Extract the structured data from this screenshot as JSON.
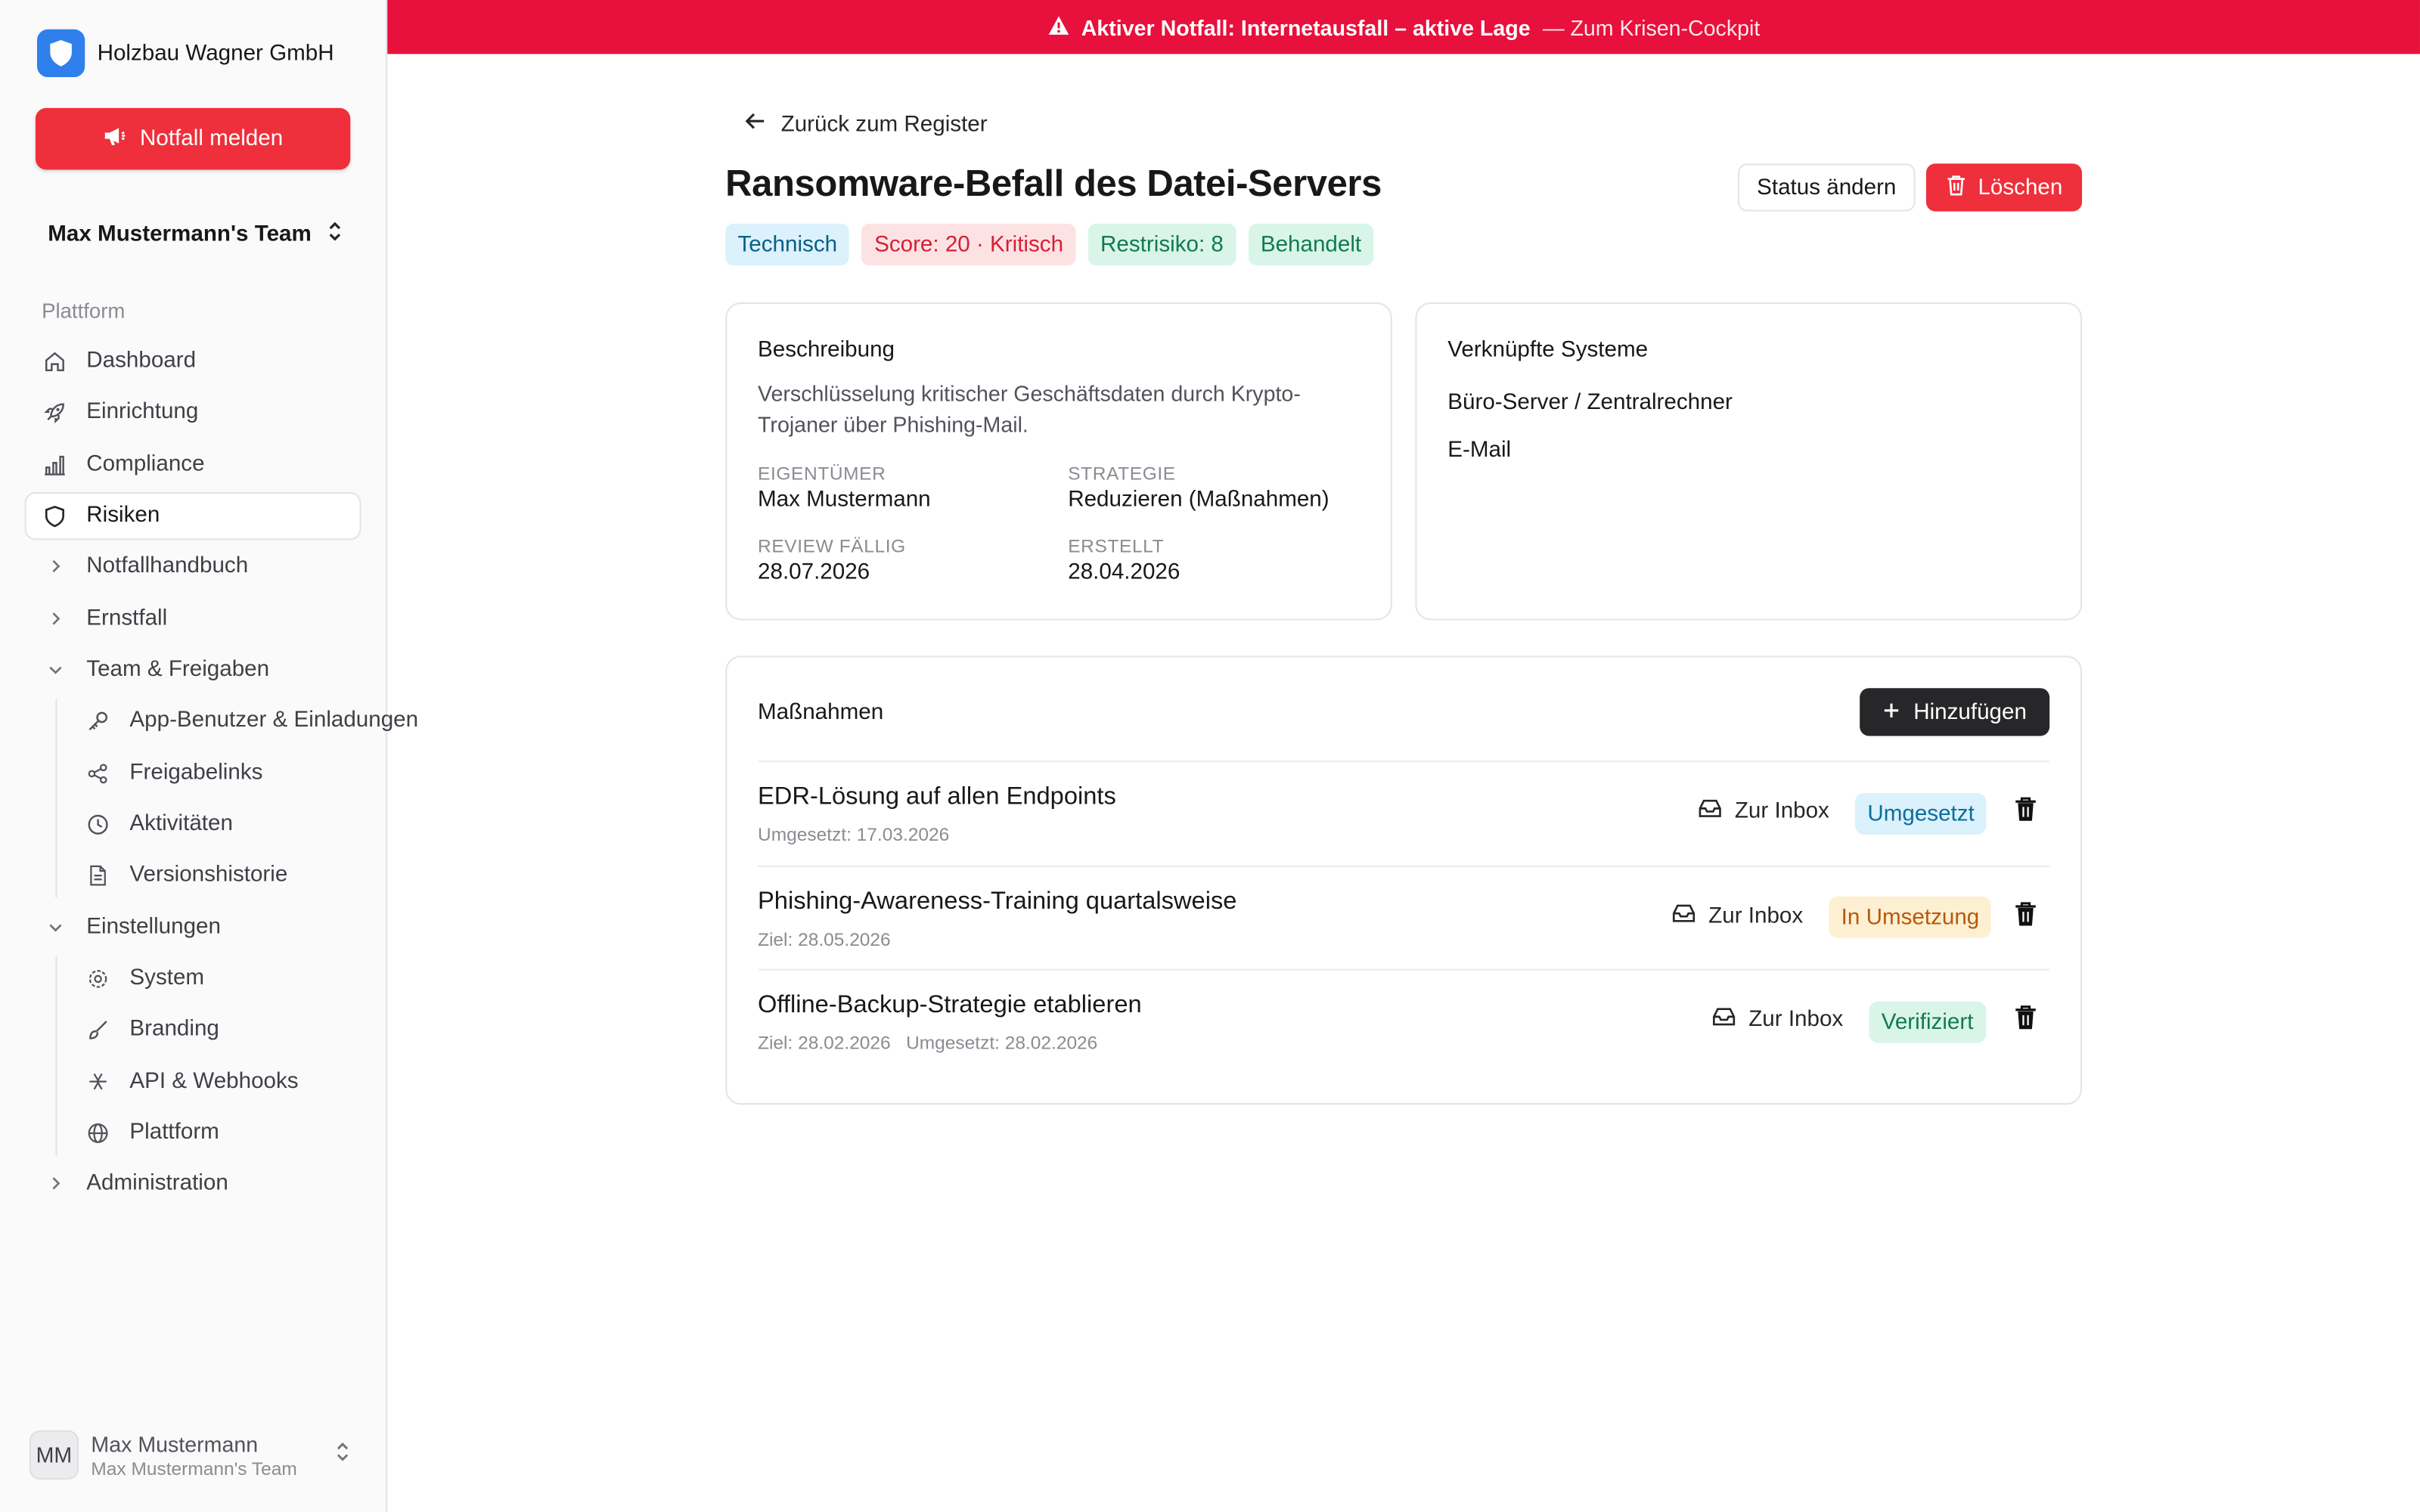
{
  "sidebar": {
    "company": "Holzbau Wagner GmbH",
    "emergency_button": "Notfall melden",
    "team_name": "Max Mustermann's Team",
    "section_label": "Plattform",
    "items": [
      {
        "label": "Dashboard",
        "icon": "home-icon"
      },
      {
        "label": "Einrichtung",
        "icon": "rocket-icon"
      },
      {
        "label": "Compliance",
        "icon": "bar-chart-icon"
      },
      {
        "label": "Risiken",
        "icon": "shield-icon",
        "active": true
      },
      {
        "label": "Notfallhandbuch",
        "icon": "chevron-right-icon"
      },
      {
        "label": "Ernstfall",
        "icon": "chevron-right-icon"
      },
      {
        "label": "Team & Freigaben",
        "icon": "chevron-down-icon"
      },
      {
        "label": "App-Benutzer & Einladungen",
        "icon": "key-icon"
      },
      {
        "label": "Freigabelinks",
        "icon": "share-icon"
      },
      {
        "label": "Aktivitäten",
        "icon": "clock-icon"
      },
      {
        "label": "Versionshistorie",
        "icon": "file-icon"
      },
      {
        "label": "Einstellungen",
        "icon": "chevron-down-icon"
      },
      {
        "label": "System",
        "icon": "gear-icon"
      },
      {
        "label": "Branding",
        "icon": "brush-icon"
      },
      {
        "label": "API & Webhooks",
        "icon": "webhook-icon"
      },
      {
        "label": "Plattform",
        "icon": "globe-icon"
      },
      {
        "label": "Administration",
        "icon": "chevron-right-icon"
      }
    ],
    "user": {
      "initials": "MM",
      "name": "Max Mustermann",
      "team": "Max Mustermann's Team"
    }
  },
  "banner": {
    "alert": "Aktiver Notfall: Internetausfall – aktive Lage",
    "link": "— Zum Krisen-Cockpit",
    "color": "#e8103c"
  },
  "header": {
    "back_link": "Zurück zum Register",
    "title": "Ransomware-Befall des Datei-Servers",
    "status_button": "Status ändern",
    "delete_button": "Löschen",
    "badges": [
      {
        "label": "Technisch",
        "bg": "#dbf1fc",
        "fg": "#0b5f86"
      },
      {
        "label": "Score: 20 · Kritisch",
        "bg": "#fde2e4",
        "fg": "#d61f33"
      },
      {
        "label": "Restrisiko: 8",
        "bg": "#d9f5ea",
        "fg": "#127a52"
      },
      {
        "label": "Behandelt",
        "bg": "#d9f5ea",
        "fg": "#127a52"
      }
    ]
  },
  "description_card": {
    "title": "Beschreibung",
    "text": "Verschlüsselung kritischer Geschäftsdaten durch Krypto-Trojaner über Phishing-Mail.",
    "meta": [
      {
        "label": "Eigentümer",
        "value": "Max Mustermann"
      },
      {
        "label": "Strategie",
        "value": "Reduzieren (Maßnahmen)"
      },
      {
        "label": "Review fällig",
        "value": "28.07.2026"
      },
      {
        "label": "Erstellt",
        "value": "28.04.2026"
      }
    ]
  },
  "systems_card": {
    "title": "Verknüpfte Systeme",
    "items": [
      "Büro-Server / Zentralrechner",
      "E-Mail"
    ]
  },
  "measures": {
    "title": "Maßnahmen",
    "add_button": "Hinzufügen",
    "inbox_label": "Zur Inbox",
    "rows": [
      {
        "title": "EDR-Lösung auf allen Endpoints",
        "sub": "Umgesetzt: 17.03.2026",
        "status": "Umgesetzt",
        "bg": "#dbf1fc",
        "fg": "#0b6f9b"
      },
      {
        "title": "Phishing-Awareness-Training quartalsweise",
        "sub": "Ziel: 28.05.2026",
        "status": "In Umsetzung",
        "bg": "#fdf0d2",
        "fg": "#b8590a"
      },
      {
        "title": "Offline-Backup-Strategie etablieren",
        "sub": "Ziel: 28.02.2026   Umgesetzt: 28.02.2026",
        "status": "Verifiziert",
        "bg": "#d9f5ea",
        "fg": "#127a52"
      }
    ]
  }
}
